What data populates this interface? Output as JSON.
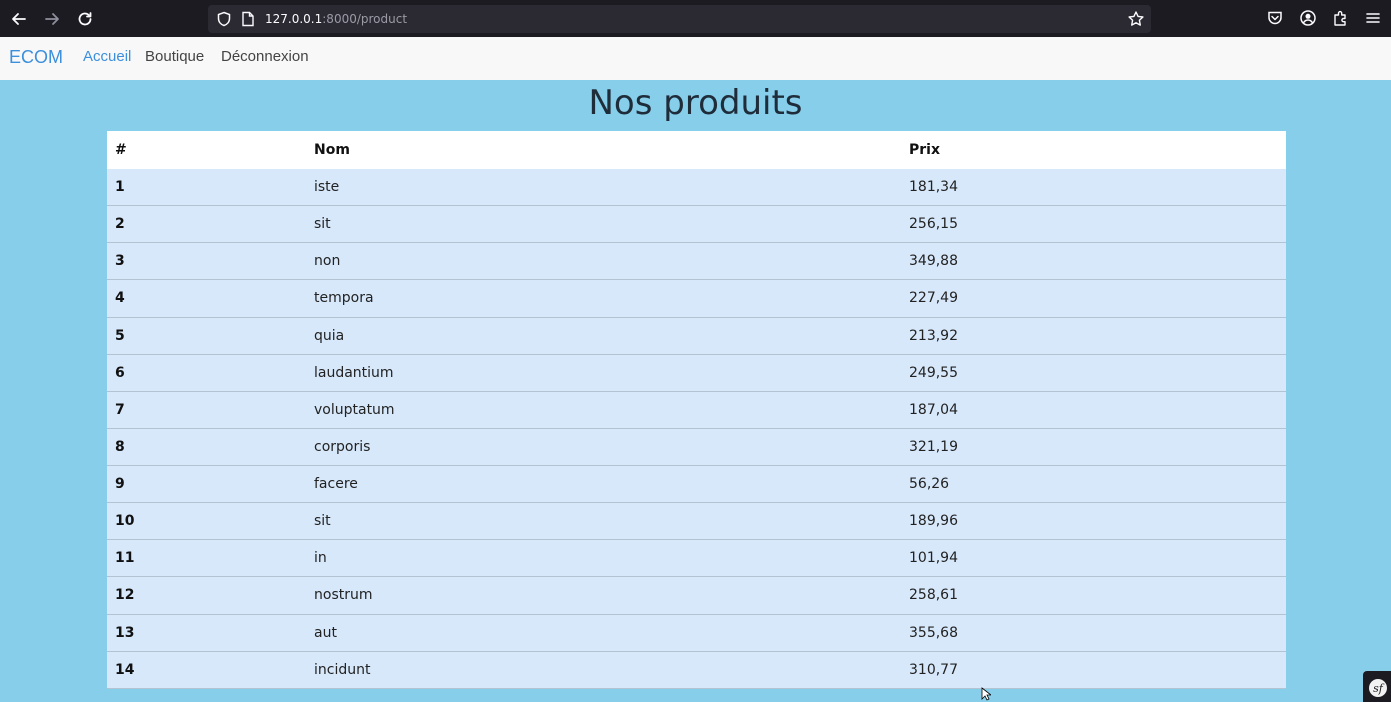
{
  "browser": {
    "url_host": "127.0.0.1",
    "url_rest": ":8000/product",
    "icons": [
      "back-icon",
      "forward-icon",
      "reload-icon",
      "shield-icon",
      "page-icon",
      "bookmark-star-icon",
      "pocket-icon",
      "account-icon",
      "extensions-icon",
      "menu-icon"
    ]
  },
  "navbar": {
    "brand": "ECOM",
    "links": [
      {
        "label": "Accueil"
      },
      {
        "label": "Boutique"
      },
      {
        "label": "Déconnexion"
      }
    ],
    "brand_color": "#3c8fdb"
  },
  "main": {
    "title": "Nos produits",
    "background": "#87ceeb",
    "table": {
      "headers": [
        "#",
        "Nom",
        "Prix"
      ],
      "rows": [
        {
          "id": "1",
          "name": "iste",
          "price": "181,34"
        },
        {
          "id": "2",
          "name": "sit",
          "price": "256,15"
        },
        {
          "id": "3",
          "name": "non",
          "price": "349,88"
        },
        {
          "id": "4",
          "name": "tempora",
          "price": "227,49"
        },
        {
          "id": "5",
          "name": "quia",
          "price": "213,92"
        },
        {
          "id": "6",
          "name": "laudantium",
          "price": "249,55"
        },
        {
          "id": "7",
          "name": "voluptatum",
          "price": "187,04"
        },
        {
          "id": "8",
          "name": "corporis",
          "price": "321,19"
        },
        {
          "id": "9",
          "name": "facere",
          "price": "56,26"
        },
        {
          "id": "10",
          "name": "sit",
          "price": "189,96"
        },
        {
          "id": "11",
          "name": "in",
          "price": "101,94"
        },
        {
          "id": "12",
          "name": "nostrum",
          "price": "258,61"
        },
        {
          "id": "13",
          "name": "aut",
          "price": "355,68"
        },
        {
          "id": "14",
          "name": "incidunt",
          "price": "310,77"
        }
      ]
    }
  },
  "badge": {
    "label": "sf"
  }
}
